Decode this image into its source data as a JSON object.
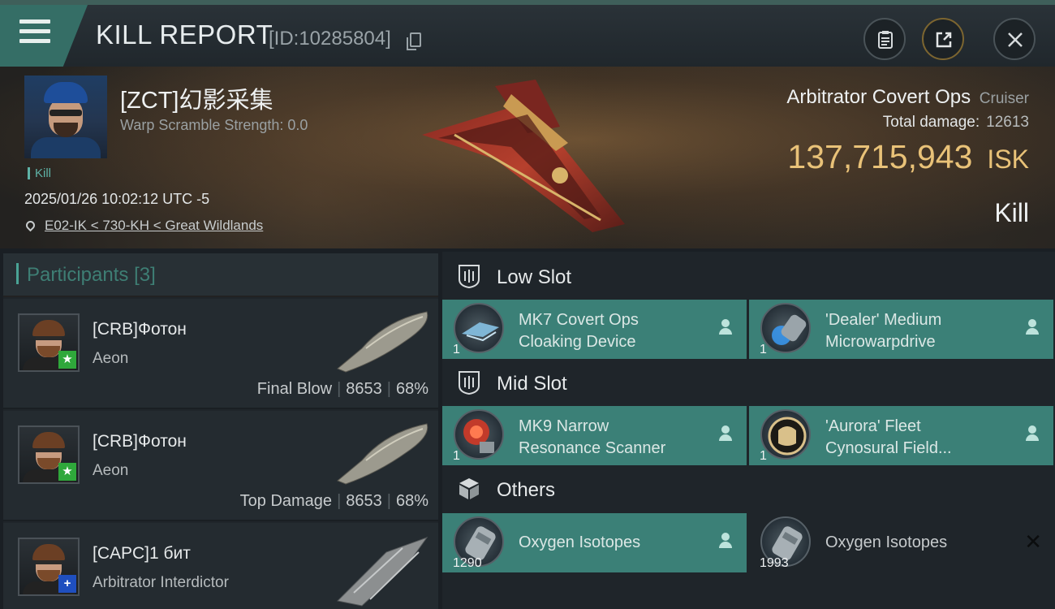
{
  "header": {
    "title": "KILL REPORT",
    "kill_id": "[ID:10285804]",
    "icons": [
      "menu-icon",
      "copy-icon",
      "clipboard-icon",
      "share-icon",
      "close-icon"
    ]
  },
  "victim": {
    "name": "[ZCT]幻影采集",
    "warp_scramble": "Warp Scramble Strength: 0.0",
    "tag": "Kill",
    "time": "2025/01/26 10:02:12 UTC -5",
    "location": "E02-IK < 730-KH < Great Wildlands",
    "ship_name": "Arbitrator Covert Ops",
    "ship_class": "Cruiser",
    "total_damage_label": "Total damage:",
    "total_damage": "12613",
    "isk_value": "137,715,943",
    "isk_unit": "ISK",
    "result": "Kill"
  },
  "participants": {
    "title": "Participants",
    "count": "[3]",
    "items": [
      {
        "name": "[CRB]Фотон",
        "ship": "Aeon",
        "role": "Final Blow",
        "damage": "8653",
        "percent": "68%",
        "badge": "star"
      },
      {
        "name": "[CRB]Фотон",
        "ship": "Aeon",
        "role": "Top Damage",
        "damage": "8653",
        "percent": "68%",
        "badge": "star"
      },
      {
        "name": "[CAPC]1 бит",
        "ship": "Arbitrator Interdictor",
        "badge": "plus"
      }
    ]
  },
  "fitting": {
    "low_slot": {
      "label": "Low Slot",
      "modules": [
        {
          "name_line1": "MK7 Covert Ops",
          "name_line2": "Cloaking Device",
          "qty": "1",
          "state": "destroyed"
        },
        {
          "name_line1": "'Dealer' Medium",
          "name_line2": "Microwarpdrive",
          "qty": "1",
          "state": "destroyed"
        }
      ]
    },
    "mid_slot": {
      "label": "Mid Slot",
      "modules": [
        {
          "name_line1": "MK9 Narrow",
          "name_line2": "Resonance Scanner",
          "qty": "1",
          "state": "destroyed"
        },
        {
          "name_line1": "'Aurora' Fleet",
          "name_line2": "Cynosural Field...",
          "qty": "1",
          "state": "destroyed"
        }
      ]
    },
    "others": {
      "label": "Others",
      "modules": [
        {
          "name_line1": "Oxygen Isotopes",
          "qty": "1290",
          "state": "destroyed"
        },
        {
          "name_line1": "Oxygen Isotopes",
          "qty": "1993",
          "state": "dropped"
        }
      ]
    }
  },
  "colors": {
    "accent": "#3b8077",
    "isk": "#e9c278",
    "badge_green": "#2fa83b",
    "badge_blue": "#1f4fbf"
  }
}
